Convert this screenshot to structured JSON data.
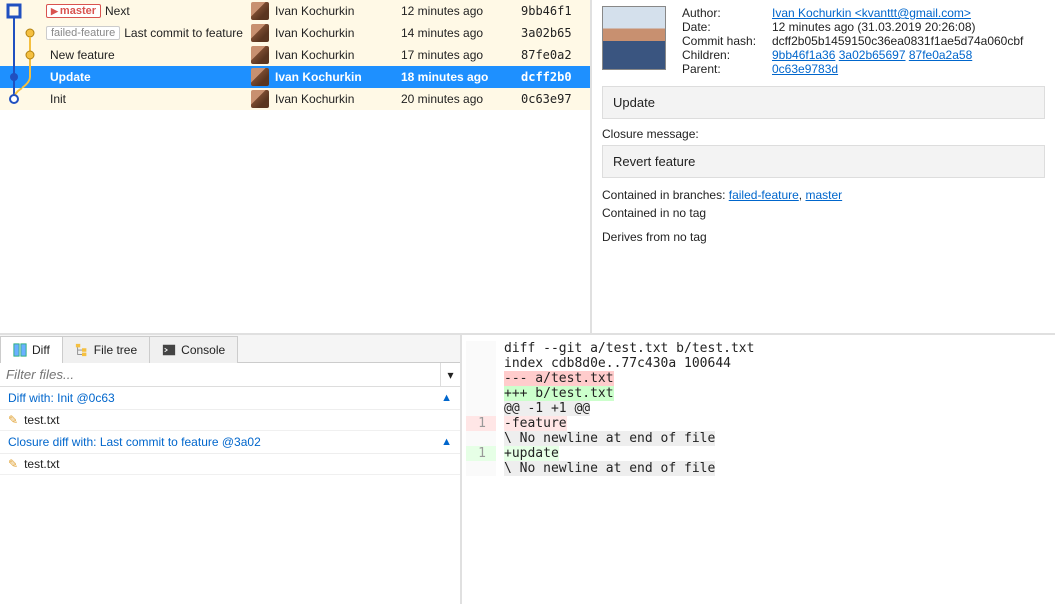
{
  "commits": [
    {
      "refs": [
        "master"
      ],
      "msg": "Next",
      "author": "Ivan Kochurkin",
      "date": "12 minutes ago",
      "hash": "9bb46f1",
      "hl": true,
      "sel": false,
      "head": true
    },
    {
      "refs": [
        "failed-feature"
      ],
      "msg": "Last commit to feature",
      "author": "Ivan Kochurkin",
      "date": "14 minutes ago",
      "hash": "3a02b65",
      "hl": true,
      "sel": false,
      "head": false
    },
    {
      "refs": [],
      "msg": "New feature",
      "author": "Ivan Kochurkin",
      "date": "17 minutes ago",
      "hash": "87fe0a2",
      "hl": true,
      "sel": false,
      "head": false
    },
    {
      "refs": [],
      "msg": "Update",
      "author": "Ivan Kochurkin",
      "date": "18 minutes ago",
      "hash": "dcff2b0",
      "hl": false,
      "sel": true,
      "head": false
    },
    {
      "refs": [],
      "msg": "Init",
      "author": "Ivan Kochurkin",
      "date": "20 minutes ago",
      "hash": "0c63e97",
      "hl": true,
      "sel": false,
      "head": false
    }
  ],
  "refLabels": {
    "master": "master",
    "failed": "failed-feature"
  },
  "details": {
    "labels": {
      "author": "Author:",
      "date": "Date:",
      "hash": "Commit hash:",
      "children": "Children:",
      "parent": "Parent:"
    },
    "authorLink": "Ivan Kochurkin <kvanttt@gmail.com>",
    "date": "12 minutes ago (31.03.2019 20:26:08)",
    "hash": "dcff2b05b1459150c36ea0831f1ae5d74a060cbf",
    "children": [
      "9bb46f1a36",
      "3a02b65697",
      "87fe0a2a58"
    ],
    "parent": "0c63e9783d",
    "commitMsg": "Update",
    "closureLabel": "Closure message:",
    "closureMsg": "Revert feature",
    "containedBranchesLabel": "Contained in branches: ",
    "branches": [
      "failed-feature",
      "master"
    ],
    "sep": ", ",
    "noTag": "Contained in no tag",
    "derives": "Derives from no tag"
  },
  "tabs": {
    "diff": "Diff",
    "tree": "File tree",
    "console": "Console"
  },
  "filterPlaceholder": "Filter files...",
  "sections": [
    {
      "title": "Diff with: Init @0c63",
      "files": [
        "test.txt"
      ]
    },
    {
      "title": "Closure diff with: Last commit to feature @3a02",
      "files": [
        "test.txt"
      ]
    }
  ],
  "diff": {
    "lines": [
      {
        "g": "",
        "cls": "",
        "t": "diff --git a/test.txt b/test.txt"
      },
      {
        "g": "",
        "cls": "",
        "t": "index cdb8d0e..77c430a 100644"
      },
      {
        "g": "",
        "cls": "bg-red-s",
        "t": "--- a/test.txt"
      },
      {
        "g": "",
        "cls": "bg-grn-s",
        "t": "+++ b/test.txt"
      },
      {
        "g": "",
        "cls": "bg-gry",
        "t": "@@ -1 +1 @@"
      },
      {
        "g": "1",
        "cls": "bg-red-l",
        "t": "-feature"
      },
      {
        "g": "",
        "cls": "bg-gry",
        "t": "\\ No newline at end of file"
      },
      {
        "g": "1",
        "cls": "bg-grn-l",
        "t": "+update"
      },
      {
        "g": "",
        "cls": "bg-gry",
        "t": "\\ No newline at end of file"
      }
    ]
  }
}
